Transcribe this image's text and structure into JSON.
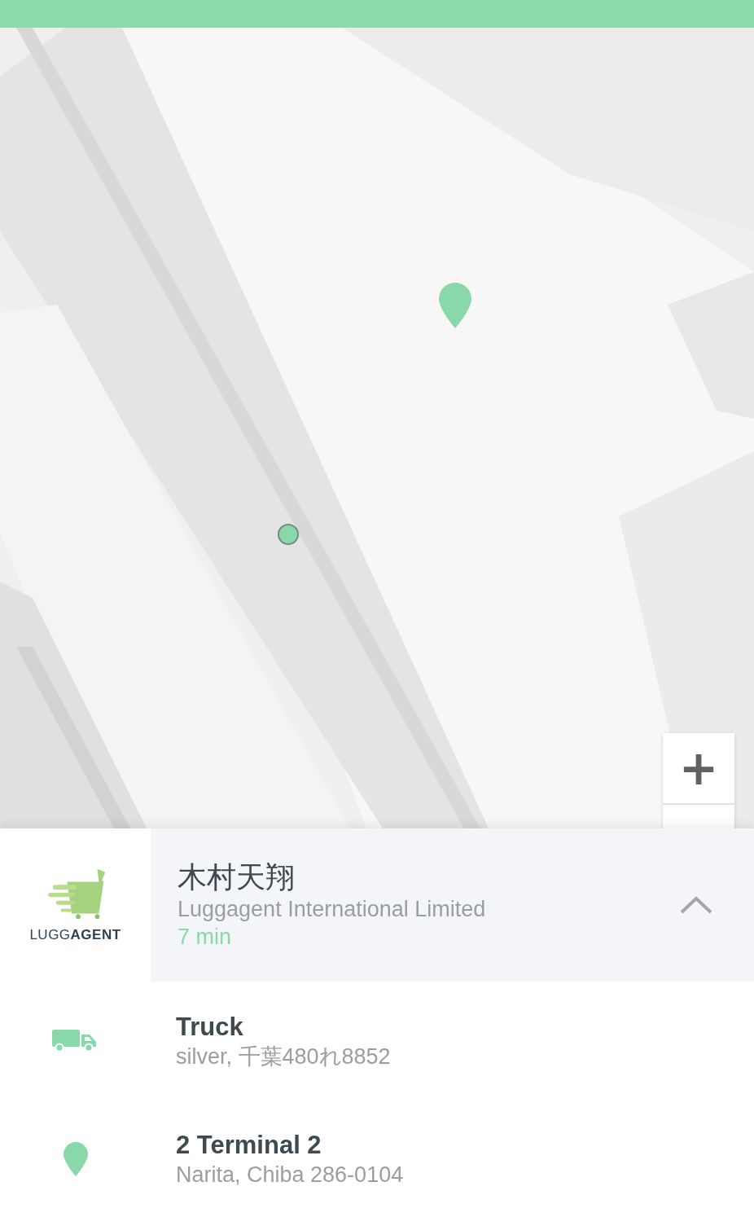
{
  "map": {
    "zoom_in": "+"
  },
  "driver": {
    "logo": "LUGG**AGENT**",
    "name": "木村天翔",
    "company": "Luggagent International Limited",
    "eta": "7 min",
    "expanded": true
  },
  "details": [
    {
      "kind": "vehicle",
      "title": "Truck",
      "subtitle": "silver, 千葉480れ8852"
    },
    {
      "kind": "location",
      "title": "2 Terminal 2",
      "subtitle": "Narita, Chiba 286-0104"
    }
  ]
}
